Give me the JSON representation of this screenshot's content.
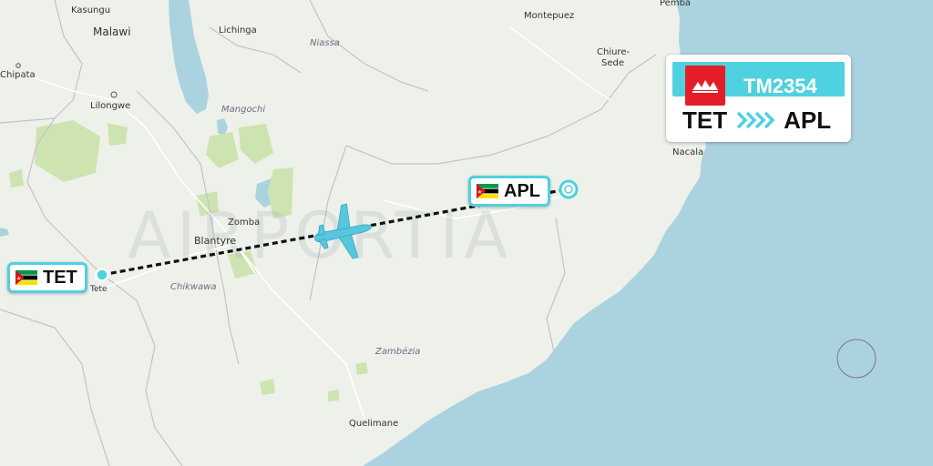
{
  "map": {
    "watermark": "AIRPORTIA",
    "cities": [
      {
        "name": "Kasungu"
      },
      {
        "name": "Malawi"
      },
      {
        "name": "Lichinga"
      },
      {
        "name": "Niassa"
      },
      {
        "name": "Montepuez"
      },
      {
        "name": "Pemba"
      },
      {
        "name": "Chipata"
      },
      {
        "name": "Lilongwe"
      },
      {
        "name": "Mangochi"
      },
      {
        "name": "Chiure-"
      },
      {
        "name": "Sede"
      },
      {
        "name": "Nacala"
      },
      {
        "name": "Zomba"
      },
      {
        "name": "Blantyre"
      },
      {
        "name": "Tete"
      },
      {
        "name": "Chikwawa"
      },
      {
        "name": "Zambézia"
      },
      {
        "name": "Quelimane"
      }
    ],
    "colors": {
      "land": "#eef0ea",
      "water": "#abd3df",
      "forest": "#cde4b0",
      "route": "#111111",
      "accent": "#4fd1df"
    }
  },
  "origin": {
    "code": "TET",
    "flag": "mozambique-flag"
  },
  "destination": {
    "code": "APL",
    "flag": "mozambique-flag"
  },
  "flight_card": {
    "flight_number": "TM2354",
    "airline_logo": "lam-airline-logo",
    "from": "TET",
    "to": "APL",
    "arrow_icon": "chevron-arrows-icon"
  }
}
